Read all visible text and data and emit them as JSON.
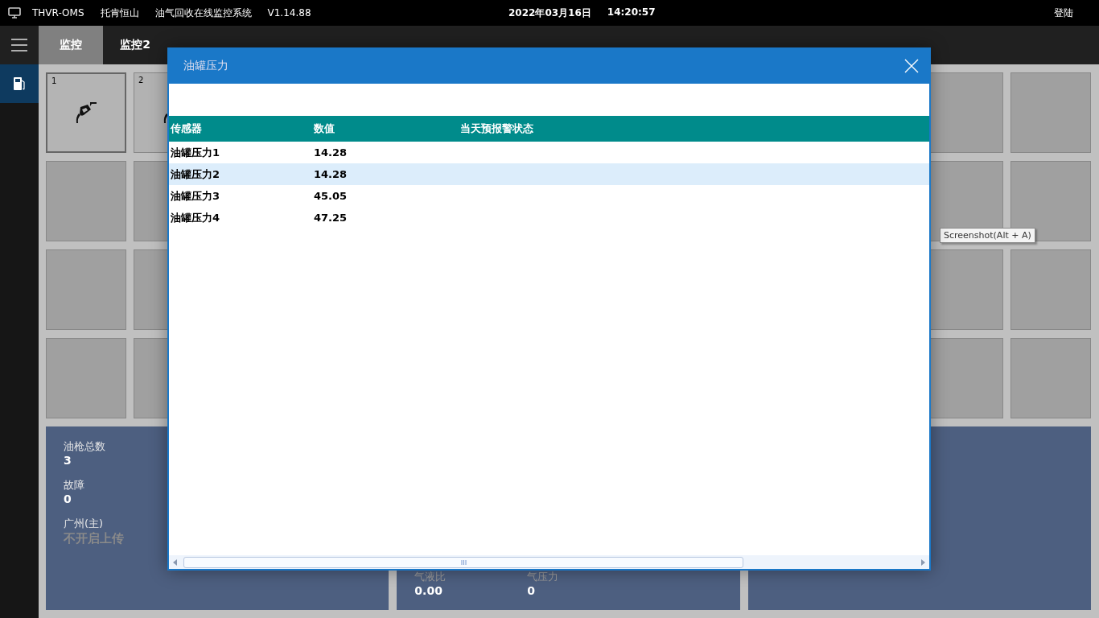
{
  "top_bar": {
    "app_code": "THVR-OMS",
    "site": "托肯恒山",
    "system_name": "油气回收在线监控系统",
    "version": "V1.14.88",
    "date": "2022年03月16日",
    "time": "14:20:57",
    "login": "登陆"
  },
  "tabs": [
    {
      "label": "监控",
      "selected": true
    },
    {
      "label": "监控2",
      "selected": false
    }
  ],
  "sidebar": {
    "items": [
      {
        "selected": true
      }
    ]
  },
  "tiles": [
    {
      "label": "1",
      "selected": true
    },
    {
      "label": "2",
      "selected": false
    }
  ],
  "summary_panels": [
    {
      "stats": [
        {
          "label": "油枪总数",
          "value": "3",
          "disabled": false
        },
        {
          "label": "故障",
          "value": "0",
          "disabled": false
        },
        {
          "label": "广州(主)",
          "value": "不开启上传",
          "disabled": true
        }
      ]
    },
    {
      "stats": [
        {
          "label": "气液比",
          "value": "0.00",
          "disabled": false
        },
        {
          "label": "气压力",
          "value": "0",
          "disabled": false
        }
      ]
    }
  ],
  "dialog": {
    "title": "油罐压力",
    "table": {
      "columns": [
        "传感器",
        "数值",
        "当天预报警状态"
      ],
      "rows": [
        {
          "cells": [
            "油罐压力1",
            "14.28"
          ],
          "selected": false
        },
        {
          "cells": [
            "油罐压力2",
            "14.28"
          ],
          "selected": true
        },
        {
          "cells": [
            "油罐压力3",
            "45.05"
          ],
          "selected": false
        },
        {
          "cells": [
            "油罐压力4",
            "47.25"
          ],
          "selected": false
        }
      ]
    }
  },
  "tooltip": "Screenshot(Alt + A)"
}
